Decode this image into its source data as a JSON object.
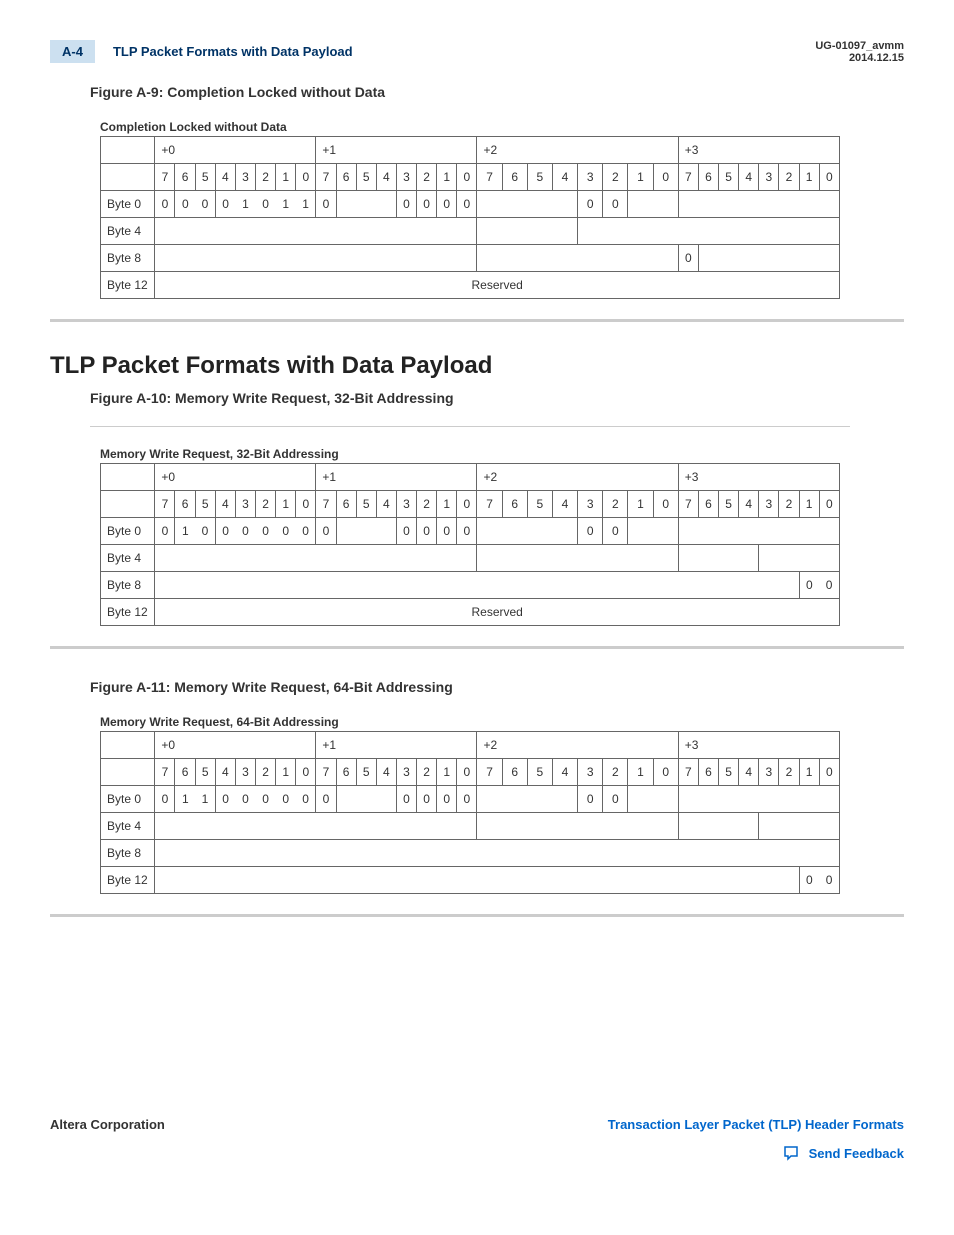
{
  "header": {
    "page_num": "A-4",
    "section_title": "TLP Packet Formats with Data Payload",
    "doc_id": "UG-01097_avmm",
    "date": "2014.12.15"
  },
  "figures": {
    "a9": {
      "title": "Figure A-9: Completion Locked without Data",
      "caption": "Completion Locked without Data",
      "offsets": [
        "+0",
        "+1",
        "+2",
        "+3"
      ],
      "bits": [
        "7",
        "6",
        "5",
        "4",
        "3",
        "2",
        "1",
        "0"
      ],
      "rows": {
        "r0_label": "Byte 0",
        "r1_label": "Byte 4",
        "r2_label": "Byte 8",
        "r3_label": "Byte 12",
        "r0_c0": [
          "0",
          "0",
          "0",
          "0",
          "1",
          "0",
          "1",
          "1"
        ],
        "r0_c1_b7": "0",
        "r0_c1_b3to0": [
          "0",
          "0",
          "0",
          "0"
        ],
        "r0_c2_b3b2": [
          "0",
          "0"
        ],
        "r2_c3_b7": "0",
        "r3_center": "Reserved"
      }
    },
    "a10": {
      "title": "Figure A-10: Memory Write Request, 32-Bit Addressing",
      "caption": "Memory Write Request, 32-Bit Addressing",
      "offsets": [
        "+0",
        "+1",
        "+2",
        "+3"
      ],
      "bits": [
        "7",
        "6",
        "5",
        "4",
        "3",
        "2",
        "1",
        "0"
      ],
      "rows": {
        "r0_label": "Byte 0",
        "r1_label": "Byte 4",
        "r2_label": "Byte 8",
        "r3_label": "Byte 12",
        "r0_c0": [
          "0",
          "1",
          "0",
          "0",
          "0",
          "0",
          "0",
          "0"
        ],
        "r0_c1_b7": "0",
        "r0_c1_b3to0": [
          "0",
          "0",
          "0",
          "0"
        ],
        "r0_c2_b3b2": [
          "0",
          "0"
        ],
        "r2_c3_last2": [
          "0",
          "0"
        ],
        "r3_center": "Reserved"
      }
    },
    "a11": {
      "title": "Figure A-11: Memory Write Request, 64-Bit Addressing",
      "caption": "Memory Write Request, 64-Bit Addressing",
      "offsets": [
        "+0",
        "+1",
        "+2",
        "+3"
      ],
      "bits": [
        "7",
        "6",
        "5",
        "4",
        "3",
        "2",
        "1",
        "0"
      ],
      "rows": {
        "r0_label": "Byte 0",
        "r1_label": "Byte 4",
        "r2_label": "Byte 8",
        "r3_label": "Byte 12",
        "r0_c0": [
          "0",
          "1",
          "1",
          "0",
          "0",
          "0",
          "0",
          "0"
        ],
        "r0_c1_b7": "0",
        "r0_c1_b3to0": [
          "0",
          "0",
          "0",
          "0"
        ],
        "r0_c2_b3b2": [
          "0",
          "0"
        ],
        "r3_c3_last2": [
          "0",
          "0"
        ]
      }
    }
  },
  "section_heading": "TLP Packet Formats with Data Payload",
  "footer": {
    "left": "Altera Corporation",
    "right_link": "Transaction Layer Packet (TLP) Header Formats",
    "feedback": "Send Feedback"
  }
}
